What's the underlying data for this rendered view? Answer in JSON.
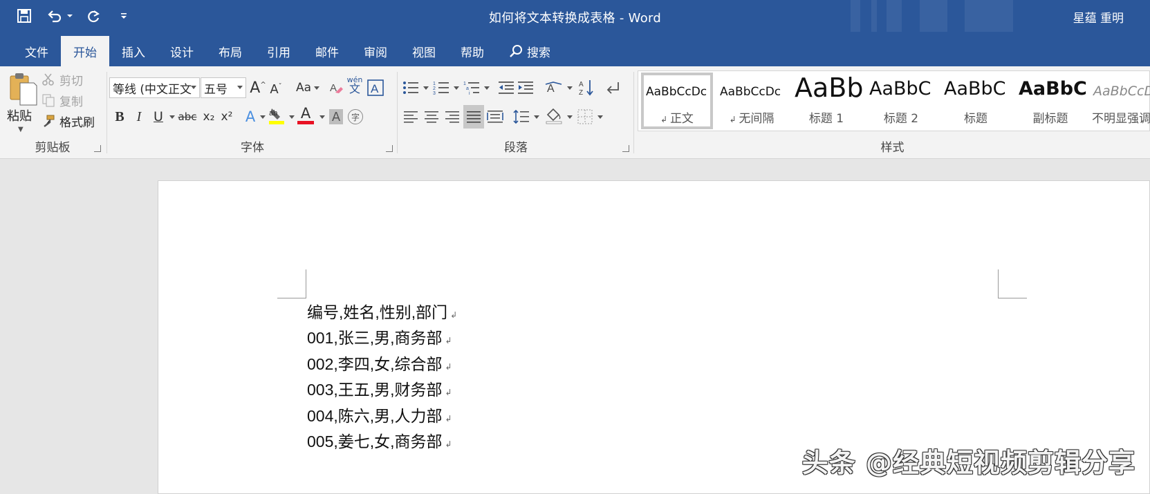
{
  "titlebar": {
    "document_title": "如何将文本转换成表格  -  Word",
    "user_name": "星蕴 重明",
    "quick_access": [
      "save-icon",
      "undo-icon",
      "redo-icon",
      "customize-qat-icon"
    ]
  },
  "tabs": [
    "文件",
    "开始",
    "插入",
    "设计",
    "布局",
    "引用",
    "邮件",
    "审阅",
    "视图",
    "帮助"
  ],
  "search_tab": "搜索",
  "active_tab": "开始",
  "clipboard": {
    "paste": "粘贴",
    "cut": "剪切",
    "copy": "复制",
    "format_painter": "格式刷",
    "label": "剪贴板"
  },
  "font": {
    "font_name": "等线 (中文正文",
    "font_size": "五号",
    "change_case": "Aa",
    "phonetic_top": "wén",
    "phonetic_bottom": "文",
    "label": "字体",
    "bold": "B",
    "italic": "I",
    "underline": "U",
    "strikethrough": "abc",
    "subscript": "x₂",
    "superscript": "x²",
    "text_effects": "A",
    "font_color": "A",
    "char_shading": "A",
    "enclose": "字",
    "highlight_color": "#ffff00",
    "font_color_value": "#e81123"
  },
  "paragraph": {
    "label": "段落"
  },
  "styles": {
    "label": "样式",
    "items": [
      {
        "preview": "AaBbCcDc",
        "name": "正文",
        "prefix": "↲ "
      },
      {
        "preview": "AaBbCcDc",
        "name": "无间隔",
        "prefix": "↲ "
      },
      {
        "preview": "AaBb",
        "name": "标题 1",
        "prefix": ""
      },
      {
        "preview": "AaBbC",
        "name": "标题 2",
        "prefix": ""
      },
      {
        "preview": "AaBbC",
        "name": "标题",
        "prefix": ""
      },
      {
        "preview": "AaBbC",
        "name": "副标题",
        "prefix": ""
      },
      {
        "preview": "AaBbCcDd",
        "name": "不明显强调",
        "prefix": ""
      }
    ]
  },
  "document": {
    "lines": [
      "编号,姓名,性别,部门",
      "001,张三,男,商务部",
      "002,李四,女,综合部",
      "003,王五,男,财务部",
      "004,陈六,男,人力部",
      "005,姜七,女,商务部"
    ],
    "paragraph_mark": "↲",
    "watermark": "头条 @经典短视频剪辑分享"
  }
}
